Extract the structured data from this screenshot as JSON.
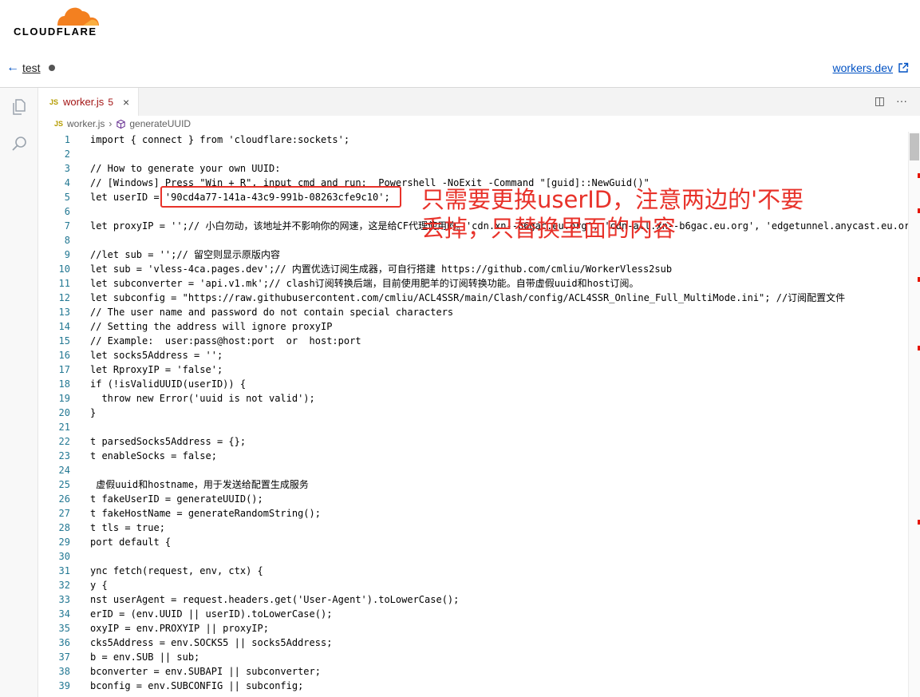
{
  "brand": {
    "name": "CLOUDFLARE"
  },
  "header": {
    "back_label": "test",
    "link_label": "workers.dev"
  },
  "tab": {
    "badge": "JS",
    "title": "worker.js",
    "problem_count": "5",
    "close": "×"
  },
  "tab_actions": {
    "split": "◫",
    "more": "···"
  },
  "breadcrumb": {
    "badge": "JS",
    "file": "worker.js",
    "sep": "›",
    "symbol": "generateUUID"
  },
  "code_lines": [
    {
      "n": "1",
      "t": "import { connect } from 'cloudflare:sockets';"
    },
    {
      "n": "2",
      "t": ""
    },
    {
      "n": "3",
      "t": "// How to generate your own UUID:"
    },
    {
      "n": "4",
      "t": "// [Windows] Press \"Win + R\", input cmd and run:  Powershell -NoExit -Command \"[guid]::NewGuid()\""
    },
    {
      "n": "5",
      "t": "let userID = '90cd4a77-141a-43c9-991b-08263cfe9c10';"
    },
    {
      "n": "6",
      "t": ""
    },
    {
      "n": "7",
      "t": "let proxyIP = '';// 小白勿动，该地址并不影响你的网速，这是给CF代理使用的。'cdn.xn--b6gac.eu.org', 'cdn-all.xn--b6gac.eu.org', 'edgetunnel.anycast.eu.org'"
    },
    {
      "n": "8",
      "t": ""
    },
    {
      "n": "9",
      "t": "//let sub = '';// 留空则显示原版内容"
    },
    {
      "n": "10",
      "t": "let sub = 'vless-4ca.pages.dev';// 内置优选订阅生成器，可自行搭建 https://github.com/cmliu/WorkerVless2sub"
    },
    {
      "n": "11",
      "t": "let subconverter = 'api.v1.mk';// clash订阅转换后端，目前使用肥羊的订阅转换功能。自带虚假uuid和host订阅。"
    },
    {
      "n": "12",
      "t": "let subconfig = \"https://raw.githubusercontent.com/cmliu/ACL4SSR/main/Clash/config/ACL4SSR_Online_Full_MultiMode.ini\"; //订阅配置文件"
    },
    {
      "n": "13",
      "t": "// The user name and password do not contain special characters"
    },
    {
      "n": "14",
      "t": "// Setting the address will ignore proxyIP"
    },
    {
      "n": "15",
      "t": "// Example:  user:pass@host:port  or  host:port"
    },
    {
      "n": "16",
      "t": "let socks5Address = '';"
    },
    {
      "n": "17",
      "t": "let RproxyIP = 'false';"
    },
    {
      "n": "18",
      "t": "if (!isValidUUID(userID)) {"
    },
    {
      "n": "19",
      "t": "  throw new Error('uuid is not valid');"
    },
    {
      "n": "20",
      "t": "}"
    },
    {
      "n": "21",
      "t": ""
    },
    {
      "n": "22",
      "t": "t parsedSocks5Address = {};"
    },
    {
      "n": "23",
      "t": "t enableSocks = false;"
    },
    {
      "n": "24",
      "t": ""
    },
    {
      "n": "25",
      "t": " 虚假uuid和hostname，用于发送给配置生成服务"
    },
    {
      "n": "26",
      "t": "t fakeUserID = generateUUID();"
    },
    {
      "n": "27",
      "t": "t fakeHostName = generateRandomString();"
    },
    {
      "n": "28",
      "t": "t tls = true;"
    },
    {
      "n": "29",
      "t": "port default {"
    },
    {
      "n": "30",
      "t": ""
    },
    {
      "n": "31",
      "t": "ync fetch(request, env, ctx) {"
    },
    {
      "n": "32",
      "t": "y {"
    },
    {
      "n": "33",
      "t": "nst userAgent = request.headers.get('User-Agent').toLowerCase();"
    },
    {
      "n": "34",
      "t": "erID = (env.UUID || userID).toLowerCase();"
    },
    {
      "n": "35",
      "t": "oxyIP = env.PROXYIP || proxyIP;"
    },
    {
      "n": "36",
      "t": "cks5Address = env.SOCKS5 || socks5Address;"
    },
    {
      "n": "37",
      "t": "b = env.SUB || sub;"
    },
    {
      "n": "38",
      "t": "bconverter = env.SUBAPI || subconverter;"
    },
    {
      "n": "39",
      "t": "bconfig = env.SUBCONFIG || subconfig;"
    }
  ],
  "annotation": {
    "text": "只需要更换userID，注意两边的'不要\n丢掉，只替换里面的内容"
  },
  "colors": {
    "annotation": "#e8322a",
    "brand_orange": "#f38020",
    "line_number": "#237893"
  }
}
